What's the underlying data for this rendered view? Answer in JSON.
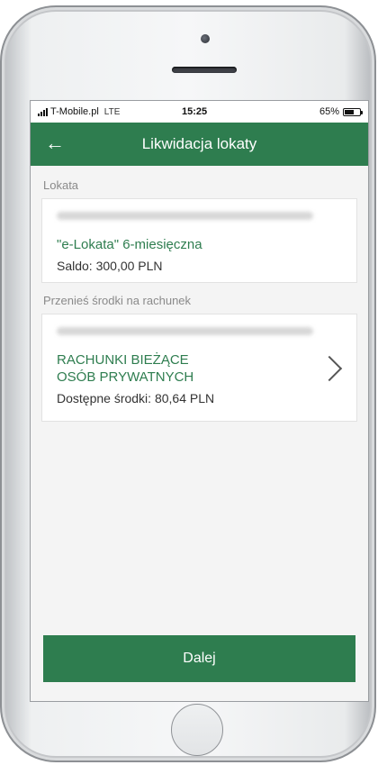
{
  "status": {
    "carrier": "T-Mobile.pl",
    "network": "LTE",
    "time": "15:25",
    "battery": "65%",
    "battery_level": 0.65
  },
  "header": {
    "title": "Likwidacja lokaty",
    "back_icon": "arrow-left-icon"
  },
  "deposit": {
    "section_label": "Lokata",
    "name": "\"e-Lokata\" 6-miesięczna",
    "balance": "Saldo: 300,00 PLN"
  },
  "transfer": {
    "section_label": "Przenieś środki na rachunek",
    "account_name_line1": "RACHUNKI BIEŻĄCE",
    "account_name_line2": "OSÓB PRYWATNYCH",
    "available": "Dostępne środki: 80,64 PLN"
  },
  "actions": {
    "next_label": "Dalej"
  },
  "colors": {
    "brand": "#2e7d4f"
  }
}
